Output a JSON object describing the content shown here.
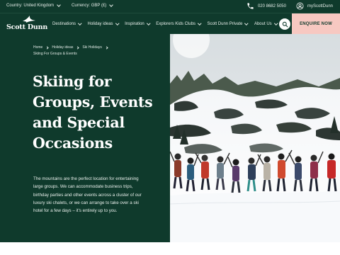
{
  "topbar": {
    "country": "Country: United Kingdom",
    "currency": "Currency: GBP (£)",
    "phone": "020 8682 5050",
    "account": "myScottDunn"
  },
  "logo": {
    "text": "Scott Dunn"
  },
  "nav": {
    "items": [
      {
        "label": "Destinations"
      },
      {
        "label": "Holiday ideas"
      },
      {
        "label": "Inspiration"
      },
      {
        "label": "Explorers Kids Clubs"
      },
      {
        "label": "Scott Dunn Private"
      },
      {
        "label": "About Us"
      }
    ],
    "enquire": "ENQUIRE NOW"
  },
  "breadcrumb": {
    "home": "Home",
    "holiday_ideas": "Holiday ideas",
    "ski_holidays": "Ski Holidays",
    "current": "Skiing For Groups & Events"
  },
  "hero": {
    "title": "Skiing for Groups, Events and Special Occasions",
    "description": "The mountains are the perfect location for entertaining large groups. We can accommodate business trips, birthday parties and other events across a cluster of our luxury ski chalets, or we can arrange to take over a ski hotel for a few days – it's entirely up to you."
  },
  "colors": {
    "brand_green": "#0f3a2c",
    "enquire_pink": "#f7c8c1"
  },
  "icons": [
    "phone-icon",
    "user-icon",
    "search-icon",
    "chevron-down-icon",
    "logo-bird-icon"
  ]
}
